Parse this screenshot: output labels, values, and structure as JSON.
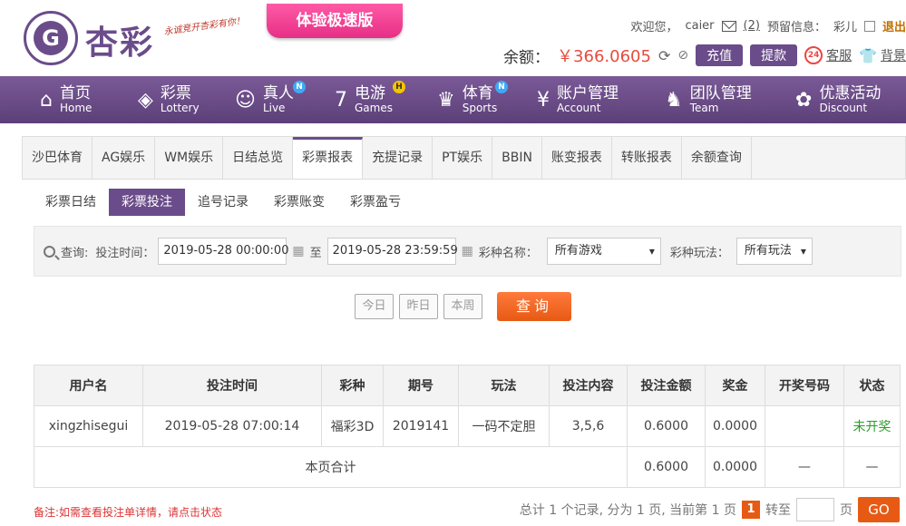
{
  "header": {
    "logo_letter": "G",
    "logo_text": "杏彩",
    "slogan": "永诚竞开杏彩有你！",
    "speed_badge": "体验极速版",
    "welcome": "欢迎您，",
    "username": "caier",
    "mail_count": "(2)",
    "reserve_label": "预留信息：",
    "reserve_value": "彩儿",
    "logout": "退出",
    "balance_label": "余额：",
    "balance_value": "￥366.0605",
    "recharge": "充值",
    "withdraw": "提款",
    "kefu_badge": "24",
    "kefu": "客服",
    "background": "背景"
  },
  "nav": {
    "items": [
      {
        "icon": "home-icon",
        "glyph": "⌂",
        "cn": "首页",
        "en": "Home",
        "badge": ""
      },
      {
        "icon": "lottery-icon",
        "glyph": "◈",
        "cn": "彩票",
        "en": "Lottery",
        "badge": ""
      },
      {
        "icon": "dealer-icon",
        "glyph": "☺",
        "cn": "真人",
        "en": "Live",
        "badge": "N"
      },
      {
        "icon": "games-icon",
        "glyph": "7",
        "cn": "电游",
        "en": "Games",
        "badge": "H"
      },
      {
        "icon": "trophy-icon",
        "glyph": "♛",
        "cn": "体育",
        "en": "Sports",
        "badge": "N"
      },
      {
        "icon": "account-icon",
        "glyph": "¥",
        "cn": "账户管理",
        "en": "Account",
        "badge": ""
      },
      {
        "icon": "team-icon",
        "glyph": "♞",
        "cn": "团队管理",
        "en": "Team",
        "badge": ""
      },
      {
        "icon": "gift-icon",
        "glyph": "✿",
        "cn": "优惠活动",
        "en": "Discount",
        "badge": ""
      }
    ],
    "badge_colors": {
      "N": "#3fa9f5",
      "H": "#f5c400"
    }
  },
  "tabs": [
    "沙巴体育",
    "AG娱乐",
    "WM娱乐",
    "日结总览",
    "彩票报表",
    "充提记录",
    "PT娱乐",
    "BBIN",
    "账变报表",
    "转账报表",
    "余额查询"
  ],
  "active_tab": 4,
  "subtabs": [
    "彩票日结",
    "彩票投注",
    "追号记录",
    "彩票账变",
    "彩票盈亏"
  ],
  "active_subtab": 1,
  "query": {
    "label": "查询:",
    "time_label": "投注时间：",
    "start_time": "2019-05-28 00:00:00",
    "to": "至",
    "end_time": "2019-05-28 23:59:59",
    "game_label": "彩种名称：",
    "game_value": "所有游戏",
    "play_label": "彩种玩法：",
    "play_value": "所有玩法",
    "today": "今日",
    "yesterday": "昨日",
    "week": "本周",
    "search": "查询"
  },
  "table": {
    "headers": [
      "用户名",
      "投注时间",
      "彩种",
      "期号",
      "玩法",
      "投注内容",
      "投注金额",
      "奖金",
      "开奖号码",
      "状态"
    ],
    "rows": [
      [
        "xingzhisegui",
        "2019-05-28 07:00:14",
        "福彩3D",
        "2019141",
        "一码不定胆",
        "3,5,6",
        "0.6000",
        "0.0000",
        "",
        "未开奖"
      ]
    ],
    "summary": {
      "label": "本页合计",
      "amount": "0.6000",
      "bonus": "0.0000",
      "draw": "—",
      "status": "—"
    }
  },
  "footer": {
    "note": "备注:如需查看投注单详情，请点击状态",
    "summary_text": "总计 1 个记录, 分为 1 页, 当前第 1 页",
    "current_page": "1",
    "goto": "转至",
    "page_unit": "页",
    "go": "GO"
  }
}
